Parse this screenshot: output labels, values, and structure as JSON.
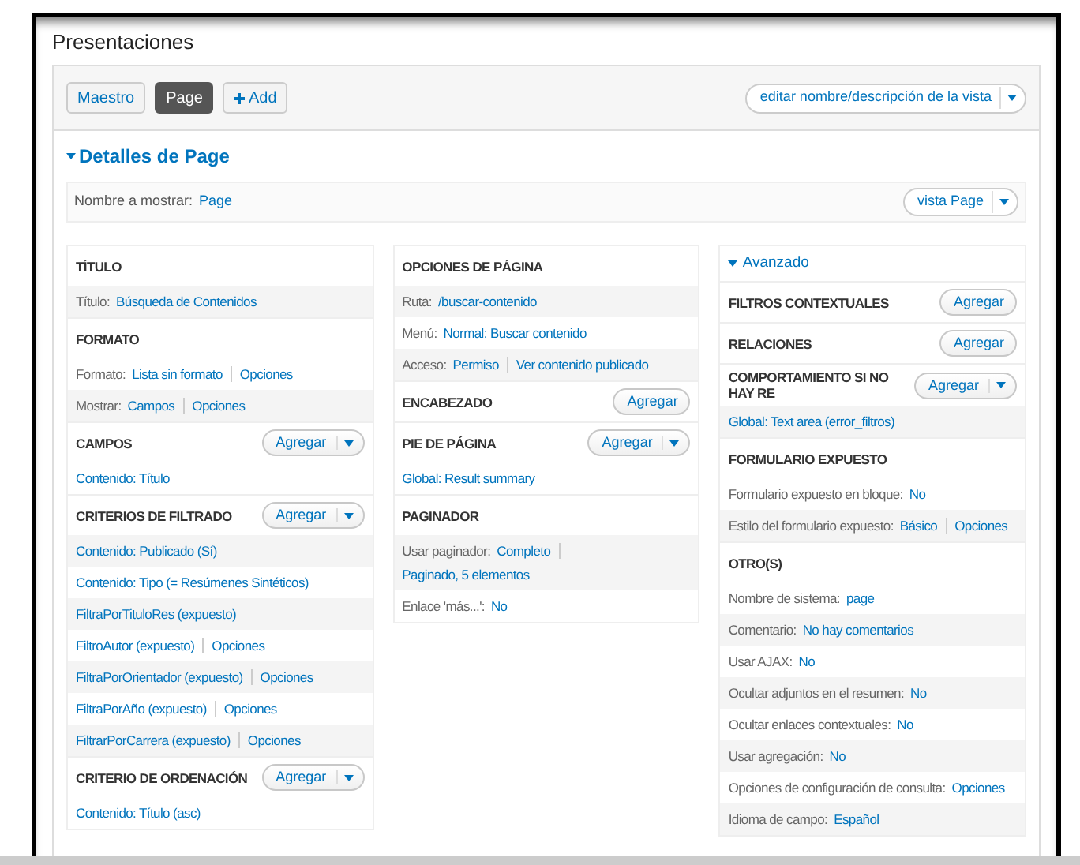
{
  "title": "Presentaciones",
  "tabs": [
    {
      "label": "Maestro",
      "selected": false
    },
    {
      "label": "Page",
      "selected": true
    }
  ],
  "add_button": "Add",
  "view_action": "editar nombre/descripción de la vista",
  "details": {
    "heading": "Detalles de Page",
    "expanded": true,
    "display_name_label": "Nombre a mostrar:",
    "display_name": "Page",
    "view_button": "vista Page"
  },
  "columns": [
    {
      "sections": [
        {
          "heading": "TÍTULO",
          "rows": [
            {
              "label": "Título:",
              "links": [
                "Búsqueda de Contenidos"
              ],
              "shaded": true
            }
          ]
        },
        {
          "heading": "FORMATO",
          "rows": [
            {
              "label": "Formato:",
              "links": [
                "Lista sin formato",
                "Opciones"
              ],
              "shaded": false
            },
            {
              "label": "Mostrar:",
              "links": [
                "Campos",
                "Opciones"
              ],
              "shaded": true
            }
          ]
        },
        {
          "heading": "CAMPOS",
          "button": {
            "label": "Agregar",
            "kind": "split"
          },
          "rows": [
            {
              "links": [
                "Contenido: Título"
              ],
              "shaded": false
            }
          ]
        },
        {
          "heading": "CRITERIOS DE FILTRADO",
          "button": {
            "label": "Agregar",
            "kind": "split"
          },
          "rows": [
            {
              "links": [
                "Contenido: Publicado (Sí)"
              ],
              "shaded": true
            },
            {
              "links": [
                "Contenido: Tipo (= Resúmenes Sintéticos)"
              ],
              "shaded": false
            },
            {
              "links": [
                "FiltraPorTituloRes (expuesto)"
              ],
              "shaded": true
            },
            {
              "links": [
                "FiltroAutor (expuesto)",
                "Opciones"
              ],
              "shaded": false
            },
            {
              "links": [
                "FiltraPorOrientador (expuesto)",
                "Opciones"
              ],
              "shaded": true
            },
            {
              "links": [
                "FiltraPorAño (expuesto)",
                "Opciones"
              ],
              "shaded": false
            },
            {
              "links": [
                "FiltrarPorCarrera (expuesto)",
                "Opciones"
              ],
              "shaded": true
            }
          ]
        },
        {
          "heading": "CRITERIO DE ORDENACIÓN",
          "button": {
            "label": "Agregar",
            "kind": "split"
          },
          "rows": [
            {
              "links": [
                "Contenido: Título (asc)"
              ],
              "shaded": false
            }
          ]
        }
      ]
    },
    {
      "sections": [
        {
          "heading": "OPCIONES DE PÁGINA",
          "rows": [
            {
              "label": "Ruta:",
              "links": [
                "/buscar-contenido"
              ],
              "shaded": true
            },
            {
              "label": "Menú:",
              "links": [
                "Normal: Buscar contenido"
              ],
              "shaded": false
            },
            {
              "label": "Acceso:",
              "links": [
                "Permiso",
                "Ver contenido publicado"
              ],
              "shaded": true
            }
          ]
        },
        {
          "heading": "ENCABEZADO",
          "button": {
            "label": "Agregar",
            "kind": "plain"
          }
        },
        {
          "heading": "PIE DE PÁGINA",
          "button": {
            "label": "Agregar",
            "kind": "split"
          },
          "rows": [
            {
              "links": [
                "Global: Result summary"
              ],
              "shaded": false
            }
          ]
        },
        {
          "heading": "PAGINADOR",
          "rows": [
            {
              "label": "Usar paginador:",
              "links": [
                "Completo",
                "Paginado, 5 elementos"
              ],
              "shaded": true
            },
            {
              "label": "Enlace 'más...':",
              "links": [
                "No"
              ],
              "shaded": false
            }
          ]
        }
      ]
    },
    {
      "toggle": {
        "label": "Avanzado",
        "expanded": true
      },
      "sections": [
        {
          "heading": "FILTROS CONTEXTUALES",
          "button": {
            "label": "Agregar",
            "kind": "plain"
          }
        },
        {
          "heading": "RELACIONES",
          "button": {
            "label": "Agregar",
            "kind": "plain"
          }
        },
        {
          "heading": "COMPORTAMIENTO SI NO HAY RE",
          "button": {
            "label": "Agregar",
            "kind": "split"
          },
          "rows": [
            {
              "links": [
                "Global: Text area (error_filtros)"
              ],
              "shaded": true
            }
          ]
        },
        {
          "heading": "FORMULARIO EXPUESTO",
          "rows": [
            {
              "label": "Formulario expuesto en bloque:",
              "links": [
                "No"
              ],
              "shaded": false
            },
            {
              "label": "Estilo del formulario expuesto:",
              "links": [
                "Básico",
                "Opciones"
              ],
              "shaded": true
            }
          ]
        },
        {
          "heading": "OTRO(S)",
          "rows": [
            {
              "label": "Nombre de sistema:",
              "links": [
                "page"
              ],
              "shaded": false
            },
            {
              "label": "Comentario:",
              "links": [
                "No hay comentarios"
              ],
              "shaded": true
            },
            {
              "label": "Usar AJAX:",
              "links": [
                "No"
              ],
              "shaded": false
            },
            {
              "label": "Ocultar adjuntos en el resumen:",
              "links": [
                "No"
              ],
              "shaded": true
            },
            {
              "label": "Ocultar enlaces contextuales:",
              "links": [
                "No"
              ],
              "shaded": false
            },
            {
              "label": "Usar agregación:",
              "links": [
                "No"
              ],
              "shaded": true
            },
            {
              "label": "Opciones de configuración de consulta:",
              "links": [
                "Opciones"
              ],
              "shaded": false
            },
            {
              "label": "Idioma de campo:",
              "links": [
                "Español"
              ],
              "shaded": true
            }
          ]
        }
      ]
    }
  ]
}
